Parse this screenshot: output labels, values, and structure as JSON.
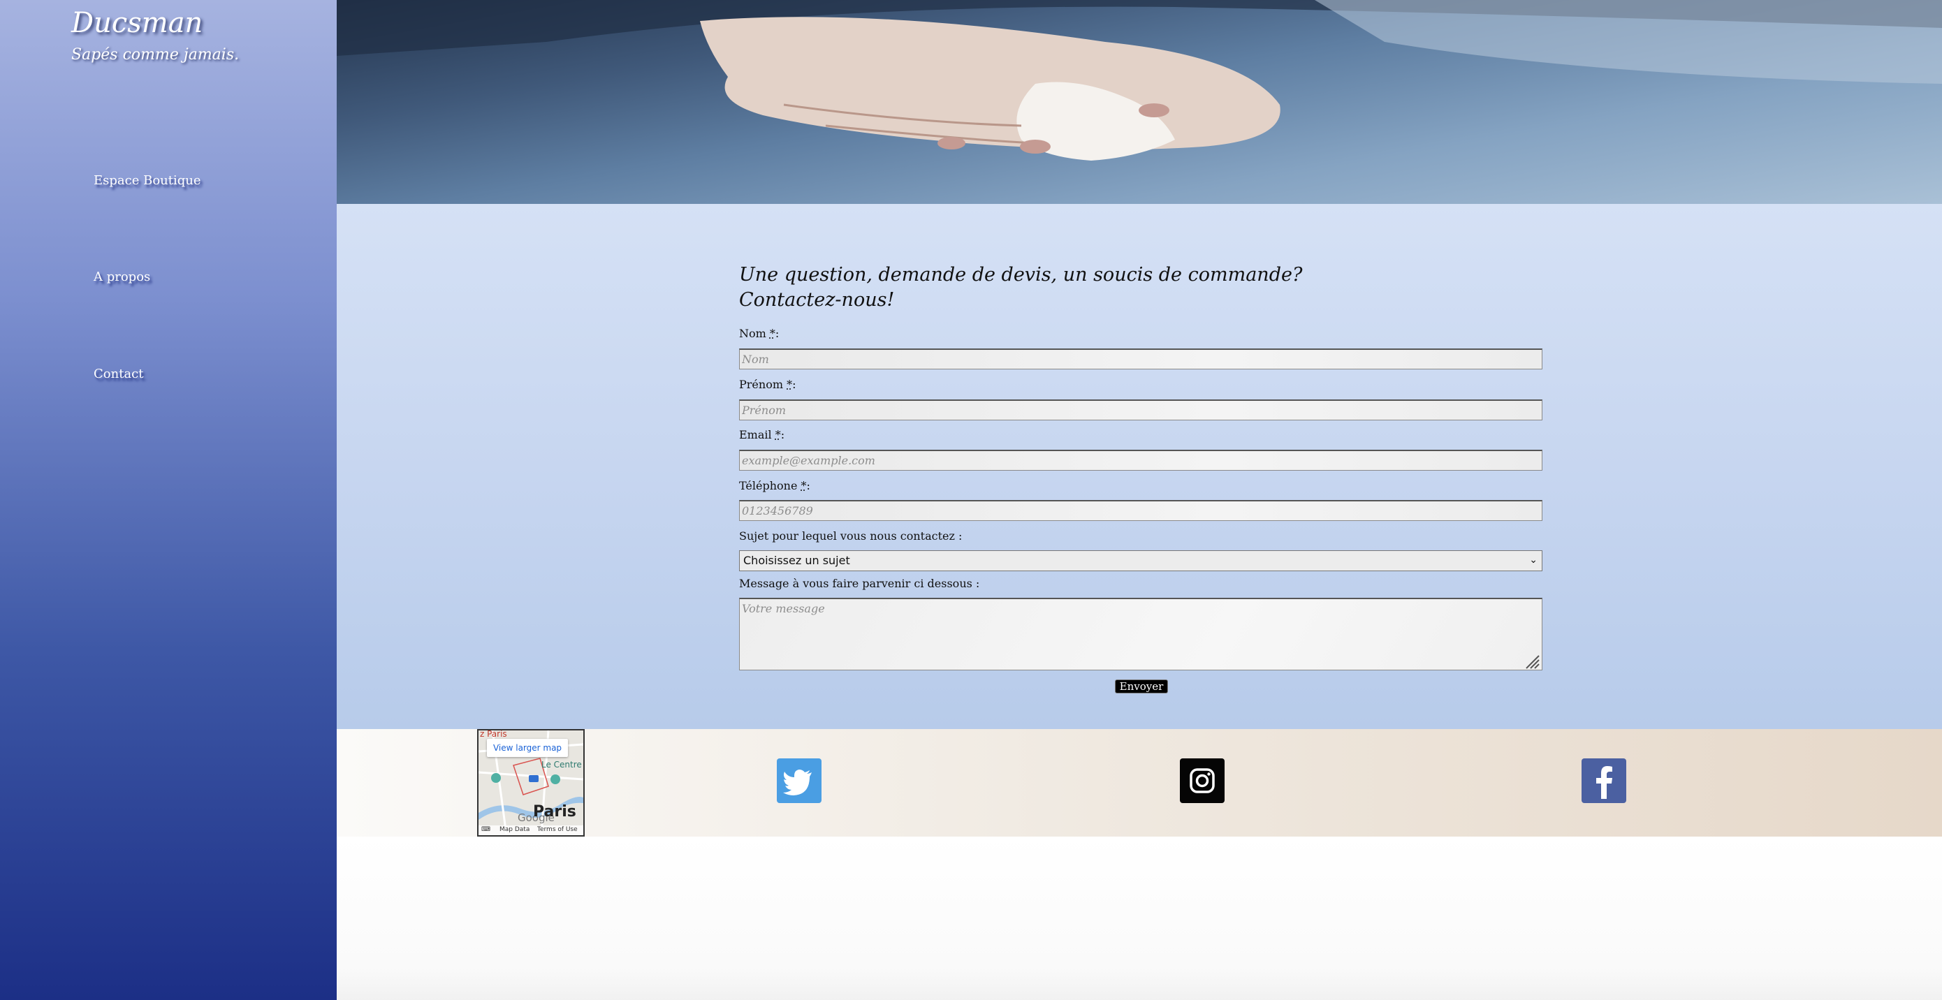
{
  "brand": {
    "name": "Ducsman",
    "tagline": "Sapés comme jamais."
  },
  "nav": {
    "items": [
      {
        "label": "Espace Boutique"
      },
      {
        "label": "A propos"
      },
      {
        "label": "Contact"
      }
    ]
  },
  "form": {
    "heading_line1": "Une question, demande de devis, un soucis de commande?",
    "heading_line2": "Contactez-nous!",
    "nom": {
      "label": "Nom",
      "suffix": ":",
      "placeholder": "Nom",
      "value": ""
    },
    "prenom": {
      "label": "Prénom",
      "suffix": ":",
      "placeholder": "Prénom",
      "value": ""
    },
    "email": {
      "label": "Email",
      "suffix": ":",
      "placeholder": "example@example.com",
      "value": ""
    },
    "telephone": {
      "label": "Téléphone",
      "suffix": ":",
      "placeholder": "0123456789",
      "value": ""
    },
    "sujet": {
      "label": "Sujet pour lequel vous nous contactez :",
      "selected": "Choisissez un sujet"
    },
    "message": {
      "label": "Message à vous faire parvenir ci dessous :",
      "placeholder": "Votre message"
    },
    "required_marker": "*",
    "submit_label": "Envoyer"
  },
  "footer": {
    "map": {
      "title": "z Paris",
      "view_larger": "View larger map",
      "city": "Paris",
      "place_label": "Le Centre",
      "google": "Google",
      "map_data": "Map Data",
      "terms": "Terms of Use"
    },
    "social": [
      {
        "icon": "twitter-icon",
        "color": "#4a9ee3"
      },
      {
        "icon": "instagram-icon",
        "color": "#050505"
      },
      {
        "icon": "facebook-icon",
        "color": "#4b60a1"
      }
    ]
  }
}
